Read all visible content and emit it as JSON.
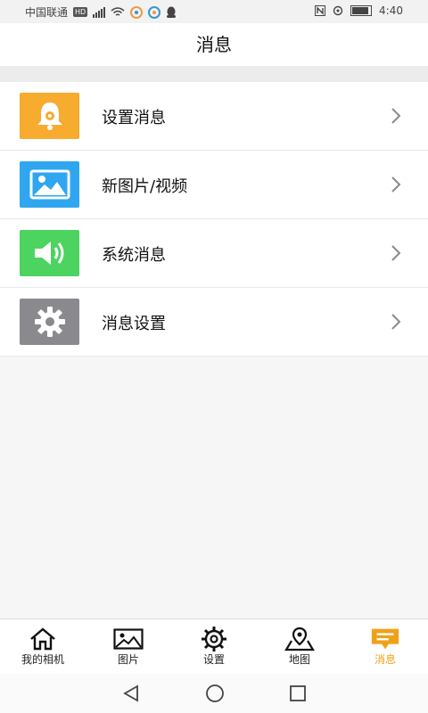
{
  "status": {
    "carrier": "中国联通",
    "hd": "HD",
    "time": "4:40"
  },
  "header": {
    "title": "消息"
  },
  "list": {
    "items": [
      {
        "label": "设置消息",
        "icon": "bell-gear-icon",
        "color": "#f7ab2f"
      },
      {
        "label": "新图片/视频",
        "icon": "image-icon",
        "color": "#2fa6ef"
      },
      {
        "label": "系统消息",
        "icon": "speaker-icon",
        "color": "#4cd360"
      },
      {
        "label": "消息设置",
        "icon": "gear-icon",
        "color": "#8a8a8e"
      }
    ]
  },
  "tabs": [
    {
      "label": "我的相机",
      "icon": "home-icon",
      "active": false
    },
    {
      "label": "图片",
      "icon": "image-icon",
      "active": false
    },
    {
      "label": "设置",
      "icon": "gear-icon",
      "active": false
    },
    {
      "label": "地图",
      "icon": "map-pin-icon",
      "active": false
    },
    {
      "label": "消息",
      "icon": "message-icon",
      "active": true
    }
  ],
  "accent": "#f0a11a"
}
